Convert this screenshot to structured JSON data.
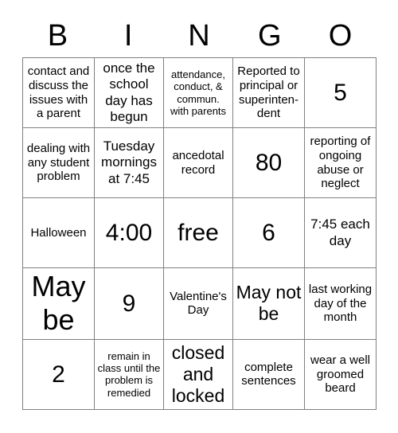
{
  "header": {
    "letters": [
      "B",
      "I",
      "N",
      "G",
      "O"
    ]
  },
  "grid": {
    "rows": [
      [
        {
          "text": "contact and discuss the issues with a parent",
          "size": "sz-s"
        },
        {
          "text": "once the school day has begun",
          "size": "sz-m"
        },
        {
          "text": "attendance, conduct, & commun. with parents",
          "size": "sz-xs"
        },
        {
          "text": "Reported to principal or superinten-dent",
          "size": "sz-s"
        },
        {
          "text": "5",
          "size": "sz-xl"
        }
      ],
      [
        {
          "text": "dealing with any student problem",
          "size": "sz-s"
        },
        {
          "text": "Tuesday mornings at 7:45",
          "size": "sz-m"
        },
        {
          "text": "ancedotal record",
          "size": "sz-s"
        },
        {
          "text": "80",
          "size": "sz-xl"
        },
        {
          "text": "reporting of ongoing abuse or neglect",
          "size": "sz-s"
        }
      ],
      [
        {
          "text": "Halloween",
          "size": "sz-s"
        },
        {
          "text": "4:00",
          "size": "sz-xl"
        },
        {
          "text": "free",
          "size": "sz-xl"
        },
        {
          "text": "6",
          "size": "sz-xl"
        },
        {
          "text": "7:45 each day",
          "size": "sz-m"
        }
      ],
      [
        {
          "text": "May be",
          "size": "sz-xxl"
        },
        {
          "text": "9",
          "size": "sz-xl"
        },
        {
          "text": "Valentine's Day",
          "size": "sz-s"
        },
        {
          "text": "May not be",
          "size": "sz-l"
        },
        {
          "text": "last working day of the month",
          "size": "sz-s"
        }
      ],
      [
        {
          "text": "2",
          "size": "sz-xl"
        },
        {
          "text": "remain in class until the problem is remedied",
          "size": "sz-xs"
        },
        {
          "text": "closed and locked",
          "size": "sz-l"
        },
        {
          "text": "complete sentences",
          "size": "sz-s"
        },
        {
          "text": "wear a well groomed beard",
          "size": "sz-s"
        }
      ]
    ]
  },
  "colors": {
    "grid_line": "#808080",
    "text": "#000000",
    "background": "#ffffff"
  }
}
